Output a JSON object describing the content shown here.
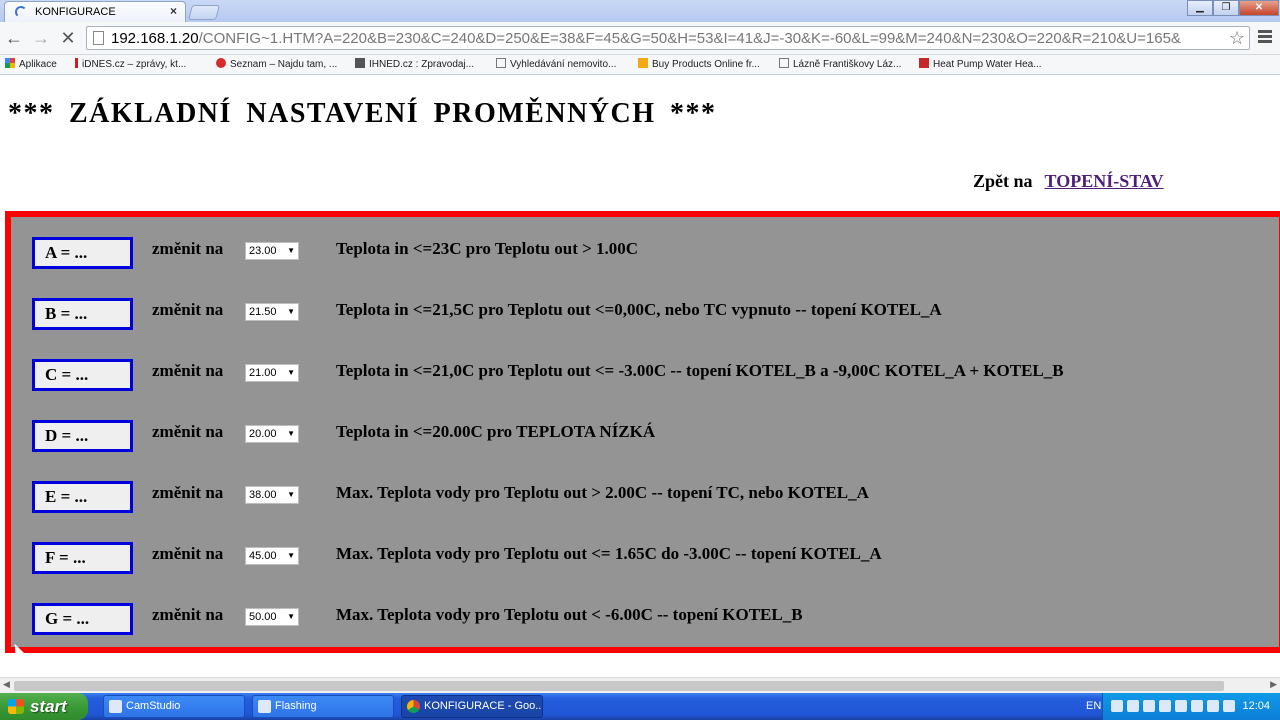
{
  "browser": {
    "tab_title": "KONFIGURACE",
    "tab_close": "×",
    "url_host": "192.168.1.20",
    "url_path": "/CONFIG~1.HTM?A=220&B=230&C=240&D=250&E=38&F=45&G=50&H=53&I=41&J=-30&K=-60&L=99&M=240&N=230&O=220&R=210&U=165&",
    "bookmarks": [
      "Aplikace",
      "iDNES.cz – zprávy, kt...",
      "Seznam – Najdu tam, ...",
      "IHNED.cz : Zpravodaj...",
      "Vyhledávání nemovito...",
      "Buy Products Online fr...",
      "Lázně Františkovy Láz...",
      "Heat Pump Water Hea..."
    ]
  },
  "page": {
    "heading": "***  ZÁKLADNÍ  NASTAVENÍ  PROMĚNNÝCH  ***",
    "back_label": "Zpět na",
    "back_link": "TOPENÍ-STAV"
  },
  "rows": [
    {
      "button": "A = ...",
      "change_label": "změnit na",
      "select": "23.00",
      "description": "Teplota in <=23C pro Teplotu out > 1.00C"
    },
    {
      "button": "B = ...",
      "change_label": "změnit na",
      "select": "21.50",
      "description": "Teplota in <=21,5C pro Teplotu out <=0,00C, nebo TC vypnuto -- topení KOTEL_A"
    },
    {
      "button": "C = ...",
      "change_label": "změnit na",
      "select": "21.00",
      "description": "Teplota in <=21,0C pro Teplotu out <= -3.00C -- topení KOTEL_B a -9,00C KOTEL_A + KOTEL_B"
    },
    {
      "button": "D = ...",
      "change_label": "změnit na",
      "select": "20.00",
      "description": "Teplota in <=20.00C pro TEPLOTA NÍZKÁ"
    },
    {
      "button": "E = ...",
      "change_label": "změnit na",
      "select": "38.00",
      "description": "Max. Teplota vody pro Teplotu out > 2.00C -- topení TC, nebo KOTEL_A"
    },
    {
      "button": "F = ...",
      "change_label": "změnit na",
      "select": "45.00",
      "description": "Max. Teplota vody pro Teplotu out <= 1.65C do -3.00C -- topení KOTEL_A"
    },
    {
      "button": "G = ...",
      "change_label": "změnit na",
      "select": "50.00",
      "description": "Max. Teplota vody pro Teplotu out < -6.00C -- topení KOTEL_B"
    }
  ],
  "taskbar": {
    "start": "start",
    "tasks": [
      "CamStudio",
      "Flashing",
      "KONFIGURACE - Goo..."
    ],
    "lang": "EN",
    "clock": "12:04"
  },
  "colors": {
    "panel_bg": "#949494",
    "panel_border": "#ff0000",
    "button_border": "#0000dd",
    "link": "#4b1f7a"
  }
}
